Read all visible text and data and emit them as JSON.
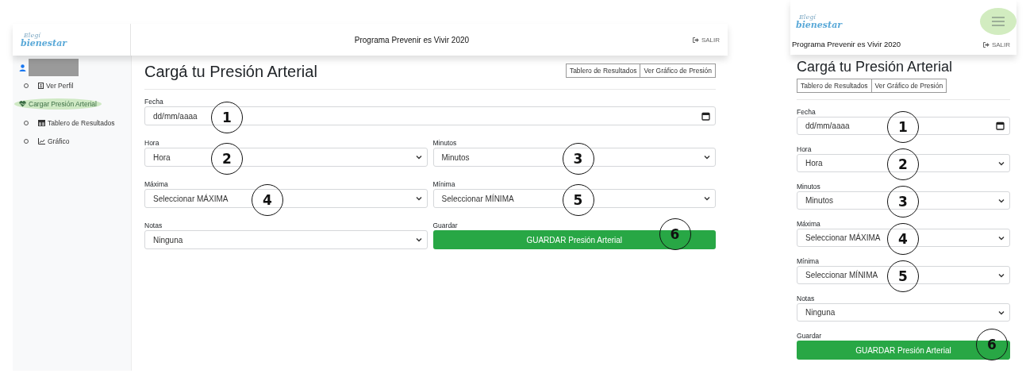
{
  "desktop": {
    "logo": {
      "line1": "Elegí",
      "line2": "bienestar"
    },
    "header_title": "Programa Prevenir es Vivir 2020",
    "logout": "SALIR",
    "sidebar": {
      "user": {
        "children": [
          {
            "label": "Ver Perfil",
            "selected": false
          }
        ]
      },
      "items": [
        {
          "label": "Cargar Presión Arterial",
          "selected": true,
          "children": [
            {
              "label": "Tablero de Resultados",
              "selected": false
            },
            {
              "label": "Gráfico",
              "selected": false
            }
          ]
        }
      ]
    },
    "page_title": "Cargá tu Presión Arterial",
    "buttons": [
      "Tablero de Resultados",
      "Ver Gráfico de Presión"
    ],
    "fields": [
      {
        "label": "Fecha",
        "kind": "date",
        "placeholder": "dd/mm/aaaa",
        "marker": "1"
      },
      {
        "label": "Hora",
        "kind": "select",
        "value": "Hora",
        "marker": "2"
      },
      {
        "label": "Minutos",
        "kind": "select",
        "value": "Minutos",
        "marker": "3"
      },
      {
        "label": "Máxima",
        "kind": "select",
        "value": "Seleccionar MÁXIMA",
        "marker": "4"
      },
      {
        "label": "Mínima",
        "kind": "select",
        "value": "Seleccionar MÍNIMA",
        "marker": "5"
      },
      {
        "label": "Notas",
        "kind": "select",
        "value": "Ninguna"
      },
      {
        "label": "Guardar",
        "kind": "button",
        "value": "GUARDAR Presión Arterial",
        "marker": "6"
      }
    ]
  },
  "mobile": {
    "logo": {
      "line1": "Elegí",
      "line2": "bienestar"
    },
    "header_title": "Programa Prevenir es Vivir 2020",
    "logout": "SALIR",
    "page_title": "Cargá tu Presión Arterial",
    "buttons": [
      "Tablero de Resultados",
      "Ver Gráfico de Presión"
    ],
    "fields": [
      {
        "label": "Fecha",
        "kind": "date",
        "placeholder": "dd/mm/aaaa",
        "marker": "1"
      },
      {
        "label": "Hora",
        "kind": "select",
        "value": "Hora",
        "marker": "2"
      },
      {
        "label": "Minutos",
        "kind": "select",
        "value": "Minutos",
        "marker": "3"
      },
      {
        "label": "Máxima",
        "kind": "select",
        "value": "Seleccionar MÁXIMA",
        "marker": "4"
      },
      {
        "label": "Mínima",
        "kind": "select",
        "value": "Seleccionar MÍNIMA",
        "marker": "5"
      },
      {
        "label": "Notas",
        "kind": "select",
        "value": "Ninguna"
      },
      {
        "label": "Guardar",
        "kind": "button",
        "value": "GUARDAR Presión Arterial",
        "marker": "6"
      }
    ]
  }
}
